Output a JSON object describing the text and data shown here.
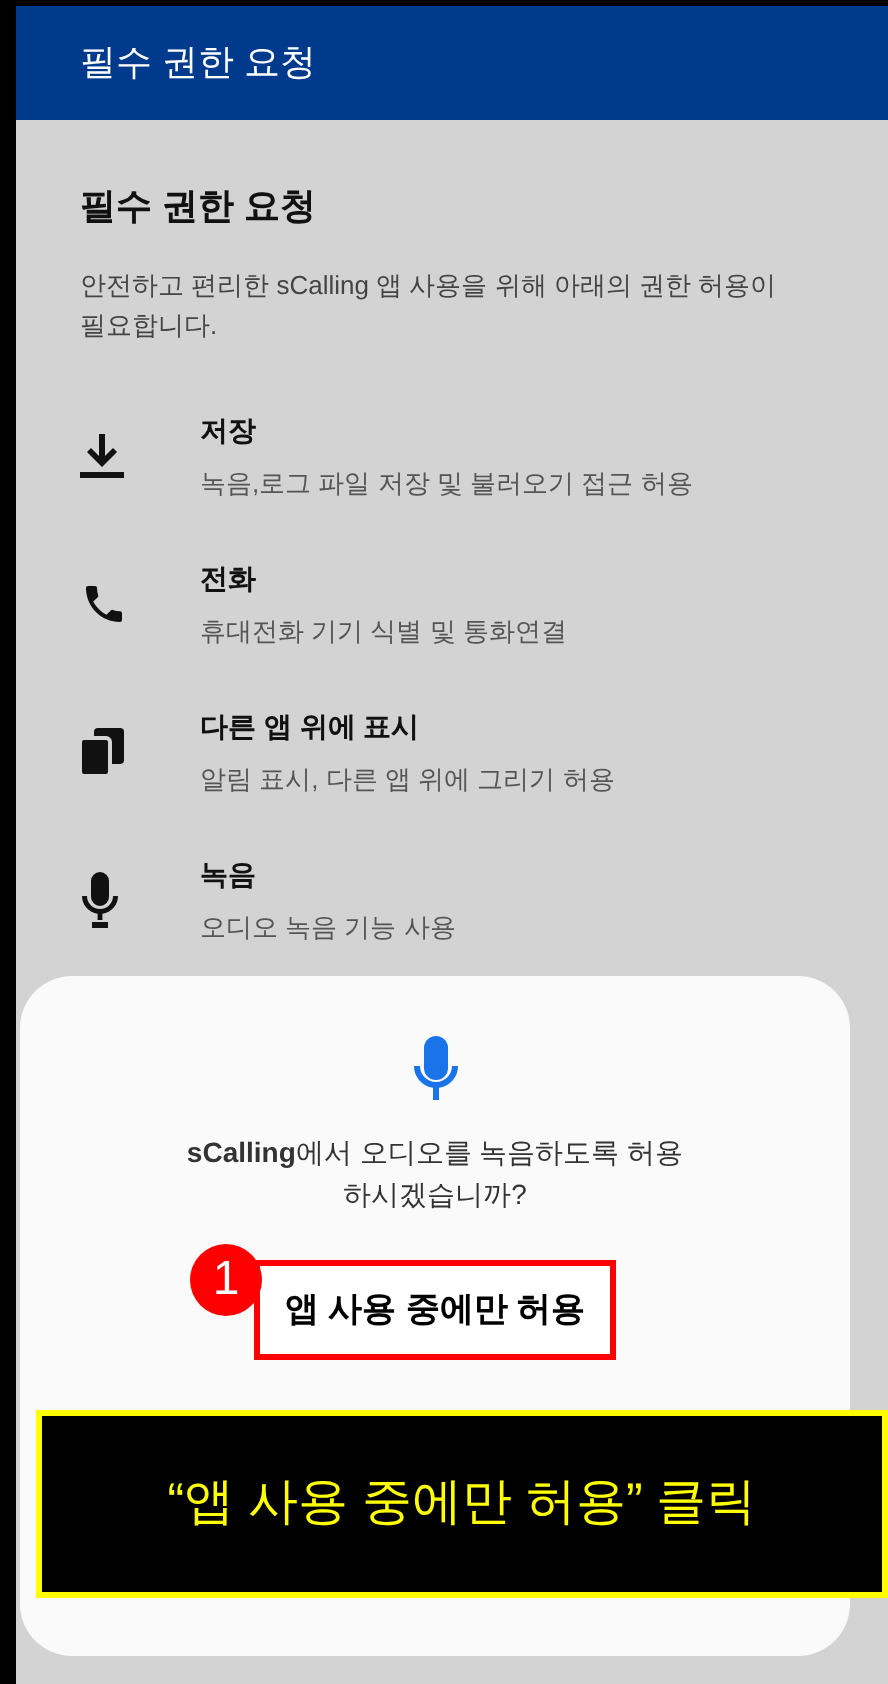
{
  "app_bar": {
    "title": "필수 권한 요청"
  },
  "heading": "필수 권한 요청",
  "description": "안전하고 편리한 sCalling 앱 사용을 위해 아래의 권한 허용이 필요합니다.",
  "permissions": [
    {
      "kind": "storage",
      "title": "저장",
      "description": "녹음,로그 파일 저장 및 불러오기 접근 허용"
    },
    {
      "kind": "phone",
      "title": "전화",
      "description": "휴대전화 기기 식별 및 통화연결"
    },
    {
      "kind": "overlay",
      "title": "다른 앱 위에 표시",
      "description": "알림 표시, 다른 앱 위에 그리기 허용"
    },
    {
      "kind": "microphone",
      "title": "녹음",
      "description": "오디오 녹음 기능 사용"
    }
  ],
  "dialog": {
    "message": "**sCalling**에서 오디오를 녹음하도록 허용하시겠습니까?",
    "button": "앱 사용 중에만 허용"
  },
  "annotation": {
    "step": "1",
    "callout": "“앱 사용 중에만 허용” 클릭"
  }
}
